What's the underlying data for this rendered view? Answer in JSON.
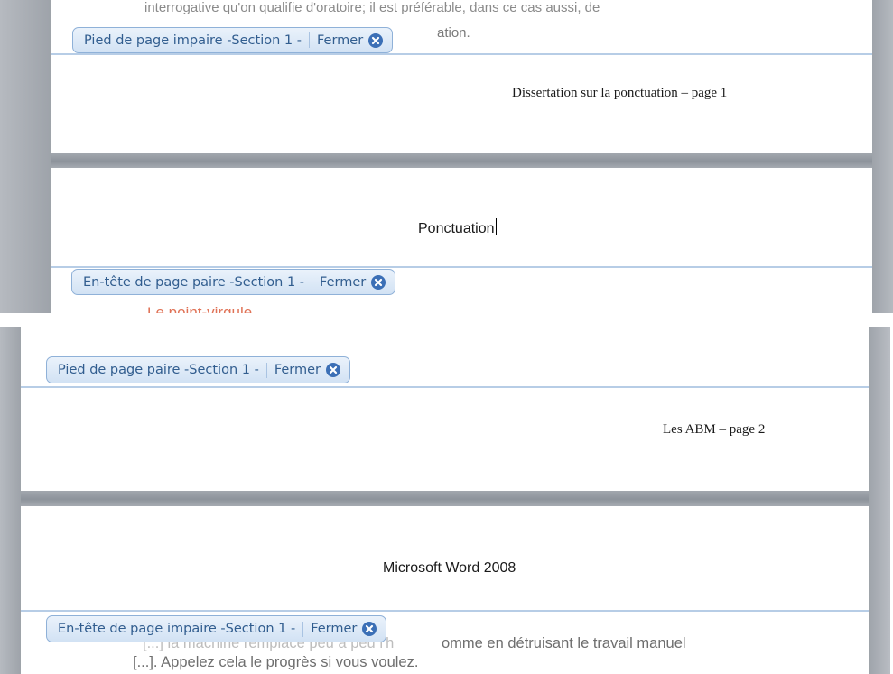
{
  "top_panel": {
    "body_text_top": "interrogative qu'on qualifie d'oratoire; il est préférable, dans ce cas aussi, de",
    "body_text_partial": "ation.",
    "footer_tab": {
      "label": "Pied de page impaire -Section 1 -",
      "close_label": "Fermer"
    },
    "footer_text": "Dissertation sur la ponctuation – page 1",
    "header_text": "Ponctuation",
    "header_tab": {
      "label": "En-tête de page paire -Section 1 -",
      "close_label": "Fermer"
    },
    "heading_partial": "Le point-virgule"
  },
  "bottom_panel": {
    "footer_tab": {
      "label": "Pied de page paire -Section 1 -",
      "close_label": "Fermer"
    },
    "footer_text": "Les ABM – page 2",
    "header_text": "Microsoft Word 2008",
    "header_tab": {
      "label": "En-tête de page impaire -Section 1 -",
      "close_label": "Fermer"
    },
    "body_line_1_obscured": "[...] la machine remplace peu à peu l'h",
    "body_line_1": "omme en détruisant le travail manuel",
    "body_line_2": "[...]. Appelez cela le progrès si vous voulez."
  },
  "colors": {
    "tab_text": "#315d8f",
    "tab_border": "#8fb1d8",
    "close_icon": "#3b6fb6",
    "heading_red": "#e07256"
  }
}
